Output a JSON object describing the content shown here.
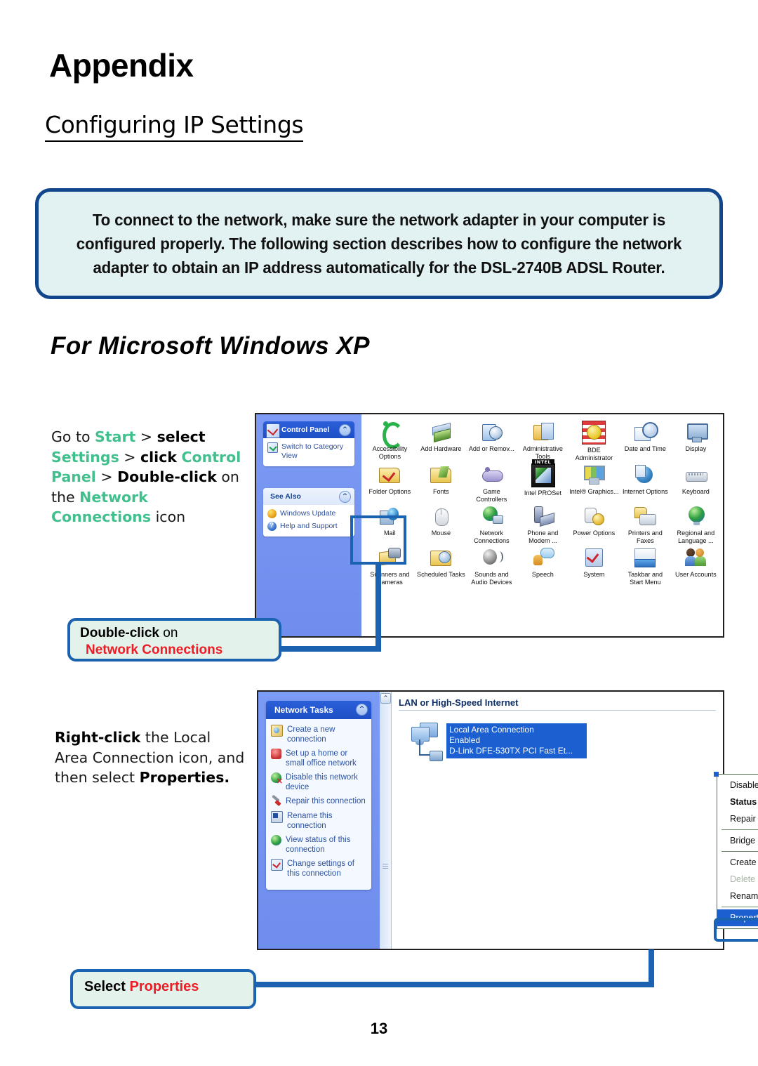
{
  "header": {
    "appendix_title": "Appendix",
    "section_title": "Configuring IP Settings"
  },
  "notice": {
    "text": "To connect to the network, make sure the network adapter in your computer is configured properly. The following section describes how to configure the network adapter to obtain an IP address automatically for the DSL-2740B ADSL Router."
  },
  "os_section": {
    "title": "For Microsoft Windows XP"
  },
  "colors": {
    "accent_green": "#41c08d",
    "accent_red": "#ee1c25",
    "callout_border": "#1b63b0",
    "callout_fill": "#e4f2ec",
    "notice_border": "#12468c",
    "notice_fill": "#e2f1f2",
    "xp_selection_blue": "#1b5fd1"
  },
  "step1": {
    "instruction_parts": [
      {
        "text": "Go to ",
        "style": "normal"
      },
      {
        "text": "Start",
        "style": "green"
      },
      {
        "text": " > ",
        "style": "normal"
      },
      {
        "text": "select",
        "style": "bold"
      },
      {
        "text": " ",
        "style": "normal"
      },
      {
        "text": "Settings",
        "style": "green"
      },
      {
        "text": " > ",
        "style": "normal"
      },
      {
        "text": "click",
        "style": "bold"
      },
      {
        "text": " ",
        "style": "normal"
      },
      {
        "text": "Control Panel",
        "style": "green"
      },
      {
        "text": " > ",
        "style": "normal"
      },
      {
        "text": "Double-click",
        "style": "bold"
      },
      {
        "text": " on the ",
        "style": "normal"
      },
      {
        "text": "Network Connections",
        "style": "green"
      },
      {
        "text": " icon",
        "style": "normal"
      }
    ],
    "callout": {
      "lead": "Double-click",
      "middle": " on",
      "emphasis": "Network Connections"
    }
  },
  "step2": {
    "instruction_parts": [
      {
        "text": "Right-click",
        "style": "bold"
      },
      {
        "text": " the Local Area Connection icon, and then select ",
        "style": "normal"
      },
      {
        "text": "Properties.",
        "style": "bold"
      }
    ],
    "callout": {
      "lead": "Select ",
      "emphasis": "Properties"
    }
  },
  "control_panel_window": {
    "sidebar": {
      "panel1": {
        "title": "Control Panel",
        "links": [
          {
            "label": "Switch to Category View",
            "icon": "switch-view-icon"
          }
        ]
      },
      "panel2": {
        "title": "See Also",
        "links": [
          {
            "label": "Windows Update",
            "icon": "windows-update-icon"
          },
          {
            "label": "Help and Support",
            "icon": "help-support-icon"
          }
        ]
      }
    },
    "icons": [
      {
        "label": "Accessibility Options",
        "icon": "accessibility-icon",
        "cls": "ic-access"
      },
      {
        "label": "Add Hardware",
        "icon": "add-hardware-icon",
        "cls": "ic-hw"
      },
      {
        "label": "Add or Remov...",
        "icon": "add-remove-programs-icon",
        "cls": "ic-addrem"
      },
      {
        "label": "Administrative Tools",
        "icon": "administrative-tools-icon",
        "cls": "ic-admin"
      },
      {
        "label": "BDE Administrator",
        "icon": "bde-administrator-icon",
        "cls": "ic-bde"
      },
      {
        "label": "Date and Time",
        "icon": "date-time-icon",
        "cls": "ic-date"
      },
      {
        "label": "Display",
        "icon": "display-icon",
        "cls": "ic-display"
      },
      {
        "label": "Folder Options",
        "icon": "folder-options-icon",
        "cls": "ic-folderopt"
      },
      {
        "label": "Fonts",
        "icon": "fonts-icon",
        "cls": "ic-fonts"
      },
      {
        "label": "Game Controllers",
        "icon": "game-controllers-icon",
        "cls": "ic-game"
      },
      {
        "label": "Intel PROSet",
        "icon": "intel-proset-icon",
        "cls": "ic-intelps"
      },
      {
        "label": "Intel® Graphics...",
        "icon": "intel-graphics-icon",
        "cls": "ic-intelgfx"
      },
      {
        "label": "Internet Options",
        "icon": "internet-options-icon",
        "cls": "ic-inet"
      },
      {
        "label": "Keyboard",
        "icon": "keyboard-icon",
        "cls": "ic-kb"
      },
      {
        "label": "Mail",
        "icon": "mail-icon",
        "cls": "ic-mail"
      },
      {
        "label": "Mouse",
        "icon": "mouse-icon",
        "cls": "ic-mouse"
      },
      {
        "label": "Network Connections",
        "icon": "network-connections-icon",
        "cls": "ic-netconn"
      },
      {
        "label": "Phone and Modem ...",
        "icon": "phone-modem-icon",
        "cls": "ic-phone"
      },
      {
        "label": "Power Options",
        "icon": "power-options-icon",
        "cls": "ic-power"
      },
      {
        "label": "Printers and Faxes",
        "icon": "printers-faxes-icon",
        "cls": "ic-print"
      },
      {
        "label": "Regional and Language ...",
        "icon": "regional-language-icon",
        "cls": "ic-regional"
      },
      {
        "label": "Scanners and Cameras",
        "icon": "scanners-cameras-icon",
        "cls": "ic-scan"
      },
      {
        "label": "Scheduled Tasks",
        "icon": "scheduled-tasks-icon",
        "cls": "ic-sched"
      },
      {
        "label": "Sounds and Audio Devices",
        "icon": "sounds-audio-icon",
        "cls": "ic-sound"
      },
      {
        "label": "Speech",
        "icon": "speech-icon",
        "cls": "ic-speech"
      },
      {
        "label": "System",
        "icon": "system-icon",
        "cls": "ic-system"
      },
      {
        "label": "Taskbar and Start Menu",
        "icon": "taskbar-start-menu-icon",
        "cls": "ic-taskbar"
      },
      {
        "label": "User Accounts",
        "icon": "user-accounts-icon",
        "cls": "ic-users"
      }
    ],
    "highlighted_icon": "Network Connections"
  },
  "network_connections_window": {
    "tasks_panel": {
      "title": "Network Tasks",
      "items": [
        {
          "label": "Create a new connection",
          "icon": "new-connection-icon",
          "cls": "newconn"
        },
        {
          "label": "Set up a home or small office network",
          "icon": "home-office-network-icon",
          "cls": "homeoff"
        },
        {
          "label": "Disable this network device",
          "icon": "disable-device-icon",
          "cls": "disable"
        },
        {
          "label": "Repair this connection",
          "icon": "repair-icon",
          "cls": "repair"
        },
        {
          "label": "Rename this connection",
          "icon": "rename-icon",
          "cls": "rename"
        },
        {
          "label": "View status of this connection",
          "icon": "view-status-icon",
          "cls": "viewstat"
        },
        {
          "label": "Change settings of this connection",
          "icon": "change-settings-icon",
          "cls": "change"
        }
      ]
    },
    "group_title": "LAN or High-Speed Internet",
    "connection": {
      "name": "Local Area Connection",
      "status": "Enabled",
      "adapter": "D-Link DFE-530TX PCI Fast Et..."
    },
    "context_menu": {
      "items": [
        {
          "label": "Disable",
          "state": "normal"
        },
        {
          "label": "Status",
          "state": "bold"
        },
        {
          "label": "Repair",
          "state": "normal"
        },
        {
          "separator": true
        },
        {
          "label": "Bridge Connections",
          "state": "normal"
        },
        {
          "separator": true
        },
        {
          "label": "Create Shortcut",
          "state": "normal"
        },
        {
          "label": "Delete",
          "state": "disabled"
        },
        {
          "label": "Rename",
          "state": "normal"
        },
        {
          "separator": true
        },
        {
          "label": "Properties",
          "state": "selected"
        }
      ]
    }
  },
  "footer": {
    "page_number": "13"
  }
}
